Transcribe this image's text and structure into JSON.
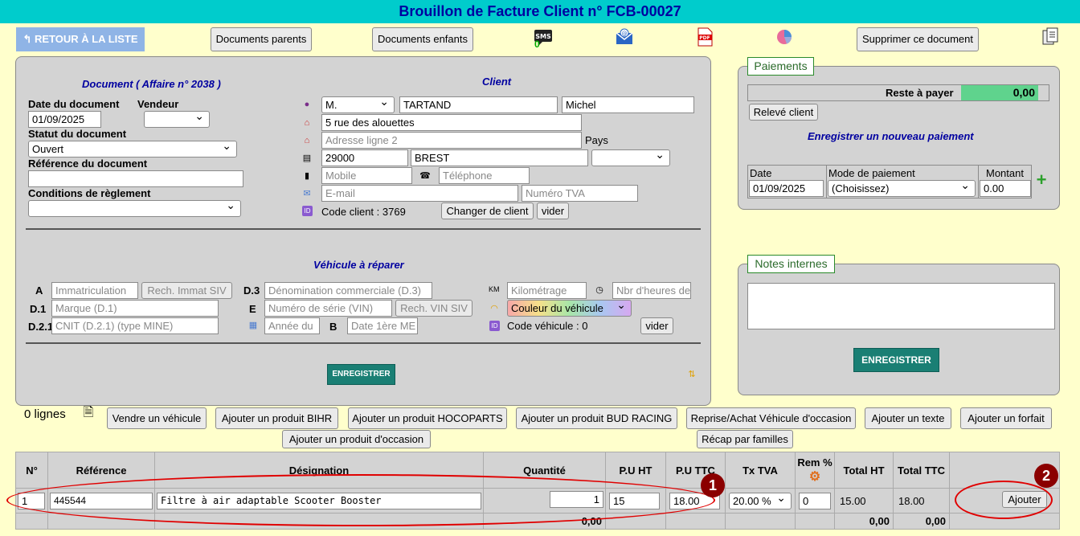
{
  "title": "Brouillon de Facture Client n° FCB-00027",
  "toolbar": {
    "back_label": "RETOUR À LA LISTE",
    "parents_label": "Documents parents",
    "enfants_label": "Documents enfants",
    "sms_count": "0",
    "delete_label": "Supprimer ce document"
  },
  "document": {
    "heading": "Document ( Affaire n° 2038 )",
    "date_label": "Date du document",
    "date_value": "01/09/2025",
    "vendeur_label": "Vendeur",
    "statut_label": "Statut du document",
    "statut_value": "Ouvert",
    "ref_label": "Référence du document",
    "conditions_label": "Conditions de règlement"
  },
  "client": {
    "heading": "Client",
    "civilite": "M.",
    "nom": "TARTAND",
    "prenom": "Michel",
    "adresse1": "5 rue des alouettes",
    "adresse2_ph": "Adresse ligne 2",
    "pays_label": "Pays",
    "cp": "29000",
    "ville": "BREST",
    "mobile_ph": "Mobile",
    "telephone_ph": "Téléphone",
    "email_ph": "E-mail",
    "tva_ph": "Numéro TVA",
    "code_client": "Code client : 3769",
    "changer_label": "Changer de client",
    "vider_label": "vider"
  },
  "vehicule": {
    "heading": "Véhicule à réparer",
    "a_label": "A",
    "d1_label": "D.1",
    "d21_label": "D.2.1",
    "d3_label": "D.3",
    "e_label": "E",
    "b_label": "B",
    "km_label": "KM",
    "immat_ph": "Immatriculation",
    "rech_immat": "Rech. Immat SIV",
    "marque_ph": "Marque (D.1)",
    "cnit_ph": "CNIT (D.2.1) (type MINE)",
    "denom_ph": "Dénomination commerciale (D.3)",
    "vin_ph": "Numéro de série (VIN)",
    "rech_vin": "Rech. VIN SIV",
    "annee_ph": "Année du",
    "date1_ph": "Date 1ère ME",
    "km_ph": "Kilométrage",
    "heures_ph": "Nbr d'heures de",
    "couleur": "Couleur du véhicule",
    "code_vehicule": "Code véhicule : 0",
    "vider_label": "vider",
    "enregistrer": "ENREGISTRER"
  },
  "paiements": {
    "tab": "Paiements",
    "reste_label": "Reste à payer",
    "reste_value": "0,00",
    "releve_label": "Relevé client",
    "nouveau_heading": "Enregistrer un nouveau paiement",
    "date_label": "Date",
    "mode_label": "Mode de paiement",
    "montant_label": "Montant",
    "date_value": "01/09/2025",
    "mode_value": "(Choisissez)",
    "montant_value": "0.00"
  },
  "notes": {
    "tab": "Notes internes",
    "enregistrer": "ENREGISTRER"
  },
  "lignes": {
    "count": "0 lignes",
    "buttons": [
      "Vendre un véhicule",
      "Ajouter un produit BIHR",
      "Ajouter un produit HOCOPARTS",
      "Ajouter un produit BUD RACING",
      "Reprise/Achat Véhicule d'occasion",
      "Ajouter un texte",
      "Ajouter un forfait",
      "Ajouter un produit d'occasion",
      "Récap par familles"
    ]
  },
  "table": {
    "headers": [
      "N°",
      "Référence",
      "Désignation",
      "Quantité",
      "P.U HT",
      "P.U TTC",
      "Tx TVA",
      "Rem %",
      "Total HT",
      "Total TTC"
    ],
    "row": {
      "num": "1",
      "reference": "445544",
      "designation": "Filtre à air adaptable Scooter Booster",
      "quantite": "1",
      "pu_ht": "15",
      "pu_ttc": "18.00",
      "tva": "20.00 %",
      "remise": "0",
      "total_ht": "15.00",
      "total_ttc": "18.00",
      "ajouter": "Ajouter"
    },
    "footer_qty": "0,00",
    "footer_ht": "0,00",
    "footer_ttc": "0,00"
  },
  "annotations": {
    "one": "1",
    "two": "2"
  }
}
